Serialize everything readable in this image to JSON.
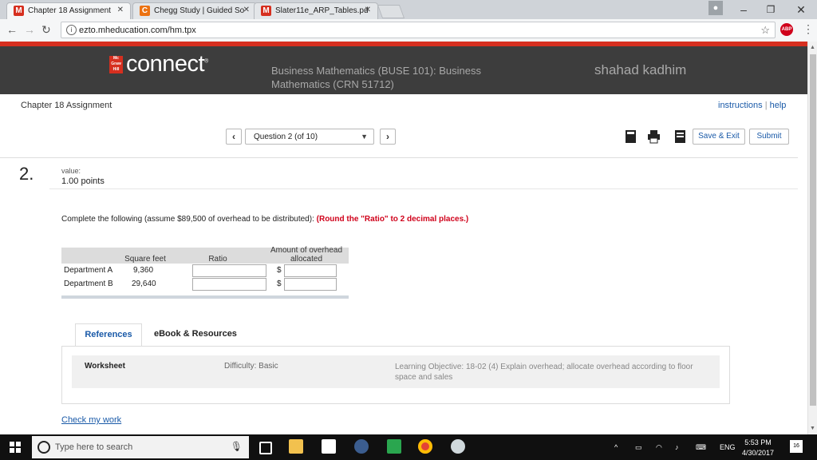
{
  "browser": {
    "tabs": [
      {
        "label": "Chapter 18 Assignment",
        "favicon": "M",
        "favicon_color": "#d62f1f",
        "active": true
      },
      {
        "label": "Chegg Study | Guided So",
        "favicon": "C",
        "favicon_color": "#ec7211",
        "active": false
      },
      {
        "label": "Slater11e_ARP_Tables.pd",
        "favicon": "M",
        "favicon_color": "#d62f1f",
        "active": false
      }
    ],
    "url": "ezto.mheducation.com/hm.tpx",
    "adblock_label": "ABP"
  },
  "header": {
    "logo_text": "connect",
    "logo_mark": "Mc Graw Hill",
    "course": "Business Mathematics (BUSE 101): Business Mathematics (CRN 51712)",
    "user": "shahad kadhim",
    "accent_color": "#d62f1f"
  },
  "assignment": {
    "title": "Chapter 18 Assignment",
    "instructions_label": "instructions",
    "help_label": "help",
    "question_select": "Question 2 (of 10)",
    "save_exit_label": "Save & Exit",
    "submit_label": "Submit"
  },
  "question": {
    "number": "2.",
    "value_label": "value:",
    "points": "1.00 points",
    "prompt": "Complete the following (assume $89,500 of overhead to be distributed):",
    "prompt_emphasis": "(Round the \"Ratio\" to 2 decimal places.)",
    "table": {
      "headers": [
        "Square feet",
        "Ratio",
        "Amount of overhead allocated"
      ],
      "rows": [
        {
          "department": "Department A",
          "square_feet": "9,360",
          "currency": "$"
        },
        {
          "department": "Department B",
          "square_feet": "29,640",
          "currency": "$"
        }
      ]
    }
  },
  "references": {
    "tab_label": "References",
    "ebook_label": "eBook & Resources",
    "worksheet_label": "Worksheet",
    "difficulty": "Difficulty: Basic",
    "objective": "Learning Objective: 18-02 (4) Explain overhead; allocate overhead according to floor space and sales",
    "check_label": "Check my work"
  },
  "taskbar": {
    "search_placeholder": "Type here to search",
    "lang": "ENG",
    "time": "5:53 PM",
    "date": "4/30/2017",
    "notifications": "16"
  }
}
